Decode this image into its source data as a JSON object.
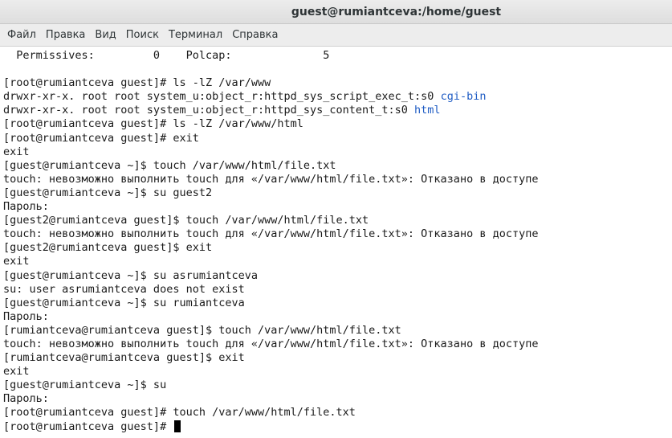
{
  "window": {
    "title": "guest@rumiantceva:/home/guest"
  },
  "menu": {
    "items": [
      "Файл",
      "Правка",
      "Вид",
      "Поиск",
      "Терминал",
      "Справка"
    ]
  },
  "terminal": {
    "lines": [
      "  Permissives:         0    Polcap:              5",
      "",
      "[root@rumiantceva guest]# ls -lZ /var/www",
      "drwxr-xr-x. root root system_u:object_r:httpd_sys_script_exec_t:s0 ",
      "drwxr-xr-x. root root system_u:object_r:httpd_sys_content_t:s0 ",
      "[root@rumiantceva guest]# ls -lZ /var/www/html",
      "[root@rumiantceva guest]# exit",
      "exit",
      "[guest@rumiantceva ~]$ touch /var/www/html/file.txt",
      "touch: невозможно выполнить touch для «/var/www/html/file.txt»: Отказано в доступе",
      "[guest@rumiantceva ~]$ su guest2",
      "Пароль:",
      "[guest2@rumiantceva guest]$ touch /var/www/html/file.txt",
      "touch: невозможно выполнить touch для «/var/www/html/file.txt»: Отказано в доступе",
      "[guest2@rumiantceva guest]$ exit",
      "exit",
      "[guest@rumiantceva ~]$ su asrumiantceva",
      "su: user asrumiantceva does not exist",
      "[guest@rumiantceva ~]$ su rumiantceva",
      "Пароль:",
      "[rumiantceva@rumiantceva guest]$ touch /var/www/html/file.txt",
      "touch: невозможно выполнить touch для «/var/www/html/file.txt»: Отказано в доступе",
      "[rumiantceva@rumiantceva guest]$ exit",
      "exit",
      "[guest@rumiantceva ~]$ su",
      "Пароль:",
      "[root@rumiantceva guest]# touch /var/www/html/file.txt",
      "[root@rumiantceva guest]# "
    ],
    "dir_names": {
      "3": "cgi-bin",
      "4": "html"
    },
    "dir_color": "#1f5cc4",
    "text_color": "#1a1a1a",
    "background_color": "#ffffff"
  }
}
